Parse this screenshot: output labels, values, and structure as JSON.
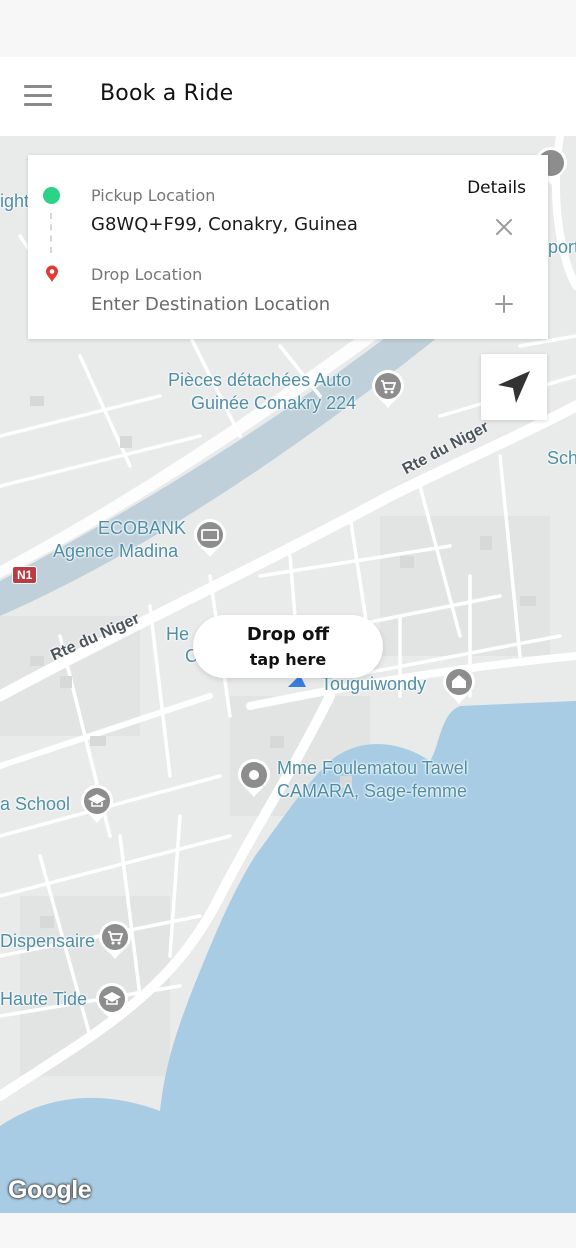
{
  "header": {
    "title": "Book a Ride",
    "menu_icon": "hamburger-menu-icon"
  },
  "location_card": {
    "pickup_label": "Pickup Location",
    "pickup_value": "G8WQ+F99, Conakry, Guinea",
    "drop_label": "Drop Location",
    "drop_placeholder": "Enter Destination Location",
    "details_label": "Details",
    "pickup_dot_color": "#2bd386",
    "drop_pin_color": "#e53935"
  },
  "dropoff_bubble": {
    "title": "Drop off",
    "subtitle": "tap here"
  },
  "map": {
    "labels": {
      "pieces_line1": "Pièces détachées Auto",
      "pieces_line2": "Guinée Conakry 224",
      "ecobank_line1": "ECOBANK",
      "ecobank_line2": "Agence Madina",
      "touguiwondy": "Touguiwondy",
      "mme_line1": "Mme Foulematou Tawel",
      "mme_line2": "CAMARA, Sage-femme",
      "school": "a School",
      "dispensaire": "Dispensaire",
      "haute_tide": "Haute Tide",
      "partial_ight": "ight",
      "partial_port": "port",
      "partial_sch": "Sch",
      "partial_he": "He",
      "partial_c": "C"
    },
    "roads": {
      "rte_niger_1": "Rte du Niger",
      "rte_niger_2": "Rte du Niger"
    },
    "route_badge": "N1",
    "attribution": "Google",
    "water_color": "#a7cce4",
    "land_color": "#e9eaea"
  }
}
